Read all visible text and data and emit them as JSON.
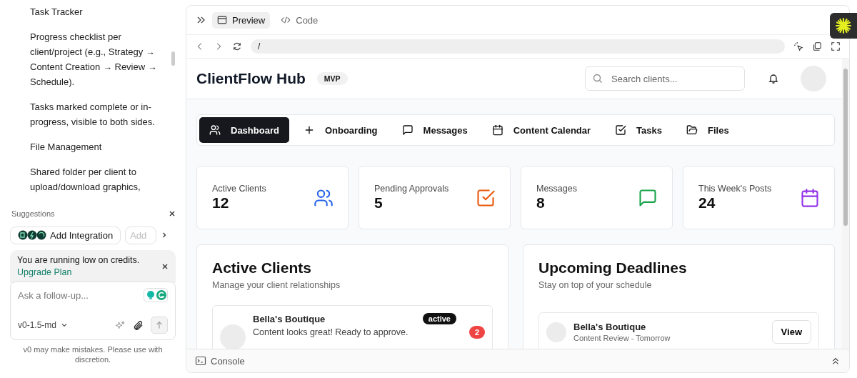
{
  "chat": {
    "paragraphs": [
      {
        "text": "Task Tracker"
      },
      {
        "text": "Progress checklist per client/project (e.g., Strategy → Content Creation → Review → Schedule)."
      },
      {
        "text": "Tasks marked complete or in-progress, visible to both sides."
      },
      {
        "text": "File Management"
      },
      {
        "text": "Shared folder per client to upload/download graphics,"
      }
    ]
  },
  "suggestions": {
    "title": "Suggestions",
    "chips": [
      {
        "label": "Add Integration"
      },
      {
        "label": "Add"
      }
    ]
  },
  "credits_notice": {
    "text": "You are running low on credits.",
    "link": "Upgrade Plan"
  },
  "composer": {
    "placeholder": "Ask a follow-up...",
    "model": "v0-1.5-md"
  },
  "disclaimer": "v0 may make mistakes. Please use with discretion.",
  "preview": {
    "tabs": [
      {
        "label": "Preview",
        "selected": true
      },
      {
        "label": "Code",
        "selected": false
      }
    ],
    "address": "/"
  },
  "app": {
    "title": "ClientFlow Hub",
    "badge": "MVP",
    "search_placeholder": "Search clients...",
    "nav": [
      {
        "label": "Dashboard",
        "kind": "users",
        "selected": true
      },
      {
        "label": "Onboarding",
        "kind": "plus",
        "selected": false
      },
      {
        "label": "Messages",
        "kind": "message",
        "selected": false
      },
      {
        "label": "Content Calendar",
        "kind": "calendar",
        "selected": false
      },
      {
        "label": "Tasks",
        "kind": "check",
        "selected": false
      },
      {
        "label": "Files",
        "kind": "folder",
        "selected": false
      }
    ],
    "stats": [
      {
        "label": "Active Clients",
        "value": "12",
        "kind": "users",
        "color": "#2563eb"
      },
      {
        "label": "Pending Approvals",
        "value": "5",
        "kind": "check",
        "color": "#ea580c"
      },
      {
        "label": "Messages",
        "value": "8",
        "kind": "message",
        "color": "#16a34a"
      },
      {
        "label": "This Week's Posts",
        "value": "24",
        "kind": "calendar",
        "color": "#9333ea"
      }
    ],
    "active_clients": {
      "title": "Active Clients",
      "subtitle": "Manage your client relationships",
      "clients": [
        {
          "name": "Bella's Boutique",
          "status": "active",
          "message": "Content looks great! Ready to approve.",
          "unread": "2"
        }
      ]
    },
    "deadlines": {
      "title": "Upcoming Deadlines",
      "subtitle": "Stay on top of your schedule",
      "items": [
        {
          "name": "Bella's Boutique",
          "detail": "Content Review - Tomorrow",
          "action": "View"
        }
      ]
    }
  },
  "console": {
    "label": "Console"
  }
}
